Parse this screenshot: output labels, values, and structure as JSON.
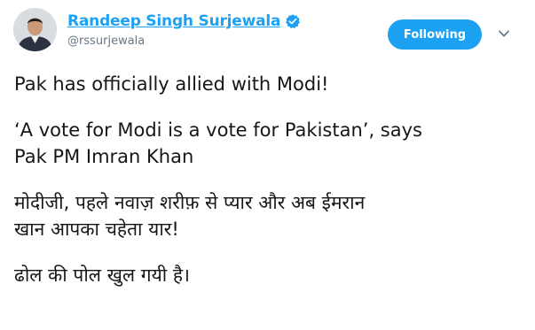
{
  "author": {
    "display_name": "Randeep Singh Surjewala",
    "handle": "@rssurjewala",
    "verified": true,
    "avatar_icon": "profile-photo-icon"
  },
  "actions": {
    "follow_label": "Following",
    "menu_icon": "chevron-down-icon"
  },
  "tweet": {
    "paragraphs": [
      {
        "lines": [
          "Pak has officially allied with Modi!"
        ]
      },
      {
        "lines": [
          "‘A vote for Modi is a vote for Pakistan’, says",
          "Pak PM Imran Khan"
        ]
      },
      {
        "lines": [
          "मोदीजी, पहले नवाज़ शरीफ़ से प्यार और अब ईमरान",
          "खान आपका चहेता यार!"
        ]
      },
      {
        "lines": [
          "ढोल की पोल खुल गयी है।"
        ]
      }
    ]
  },
  "colors": {
    "accent": "#1da1f2",
    "text": "#14171a",
    "secondary": "#657786"
  }
}
